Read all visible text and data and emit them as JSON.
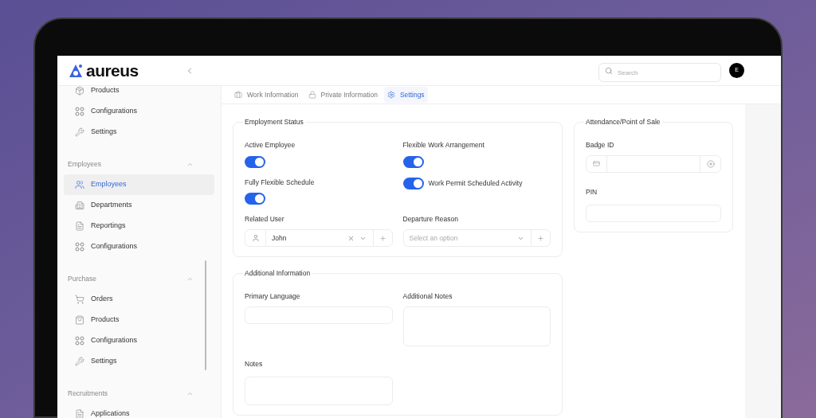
{
  "brand": {
    "name": "aureus"
  },
  "search": {
    "placeholder": "Search"
  },
  "user": {
    "initial": "E"
  },
  "sidebar": {
    "items": [
      {
        "label": "Products",
        "kind": "box",
        "selected": false
      },
      {
        "label": "Configurations",
        "kind": "grid",
        "selected": false
      },
      {
        "label": "Settings",
        "kind": "wrench",
        "selected": false
      }
    ],
    "groups": [
      {
        "title": "Employees",
        "expanded": true,
        "items": [
          {
            "label": "Employees",
            "kind": "users",
            "selected": true
          },
          {
            "label": "Departments",
            "kind": "building",
            "selected": false
          },
          {
            "label": "Reportings",
            "kind": "file",
            "selected": false
          },
          {
            "label": "Configurations",
            "kind": "grid",
            "selected": false
          }
        ]
      },
      {
        "title": "Purchase",
        "expanded": true,
        "items": [
          {
            "label": "Orders",
            "kind": "cart",
            "selected": false
          },
          {
            "label": "Products",
            "kind": "bag",
            "selected": false
          },
          {
            "label": "Configurations",
            "kind": "grid",
            "selected": false
          },
          {
            "label": "Settings",
            "kind": "wrench",
            "selected": false
          }
        ]
      },
      {
        "title": "Recruitments",
        "expanded": true,
        "items": [
          {
            "label": "Applications",
            "kind": "file",
            "selected": false
          }
        ]
      }
    ]
  },
  "tabs": [
    {
      "label": "Work Information",
      "kind": "briefcase",
      "selected": false
    },
    {
      "label": "Private Information",
      "kind": "lock",
      "selected": false
    },
    {
      "label": "Settings",
      "kind": "gear",
      "selected": true
    }
  ],
  "employment_status": {
    "title": "Employment Status",
    "toggles": [
      {
        "label": "Active Employee",
        "on": true,
        "kind": "stacked"
      },
      {
        "label": "Flexible Work Arrangement",
        "on": true,
        "kind": "stacked"
      },
      {
        "label": "Fully Flexible Schedule",
        "on": true,
        "kind": "stacked"
      },
      {
        "label": "Work Permit Scheduled Activity",
        "on": true,
        "kind": "inline"
      }
    ],
    "related_user": {
      "label": "Related User",
      "value": "John"
    },
    "departure_reason": {
      "label": "Departure Reason",
      "placeholder": "Select an option"
    }
  },
  "attendance": {
    "title": "Attendance/Point of Sale",
    "badge_id": {
      "label": "Badge ID"
    },
    "pin": {
      "label": "PIN"
    }
  },
  "additional_information": {
    "title": "Additional Information",
    "primary_language": {
      "label": "Primary Language"
    },
    "additional_notes": {
      "label": "Additional Notes"
    },
    "notes": {
      "label": "Notes"
    }
  }
}
